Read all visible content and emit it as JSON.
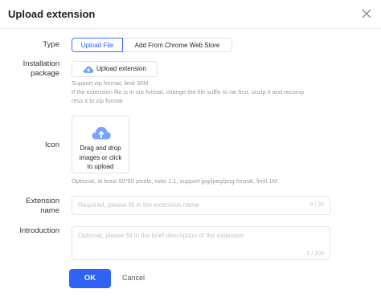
{
  "dialog": {
    "title": "Upload extension"
  },
  "colors": {
    "accent": "#2f63f5",
    "cloud": "#7aa2ff"
  },
  "type_field": {
    "label": "Type",
    "tabs": [
      {
        "label": "Upload File",
        "active": true
      },
      {
        "label": "Add From Chrome Web Store",
        "active": false
      }
    ]
  },
  "package_field": {
    "label_line1": "Installation",
    "label_line2": "package",
    "button_label": "Upload extension",
    "button_icon": "cloud-upload-icon",
    "hint_line1": "Support zip format, limit 30M",
    "hint_line2": "If the extension file is in crx format, change the file suffix to rar first, unzip it and recomp",
    "hint_line3": "ress it to zip format"
  },
  "icon_field": {
    "label": "Icon",
    "dropzone_icon": "cloud-upload-icon",
    "dropzone_line1": "Drag and drop",
    "dropzone_line2": "images or click",
    "dropzone_line3": "to upload",
    "hint": "Optional, at least 60*60 pixels, ratio 1:1, support jpg/jpeg/png format, limit 1M"
  },
  "name_field": {
    "label_line1": "Extension",
    "label_line2": "name",
    "placeholder": "Required, please fill in the extension name",
    "counter": "0 / 20"
  },
  "intro_field": {
    "label": "Introduction",
    "placeholder": "Optional, please fill in the brief description of the extension",
    "counter": "0 / 200"
  },
  "footer": {
    "ok_label": "OK",
    "cancel_label": "Cancel"
  }
}
